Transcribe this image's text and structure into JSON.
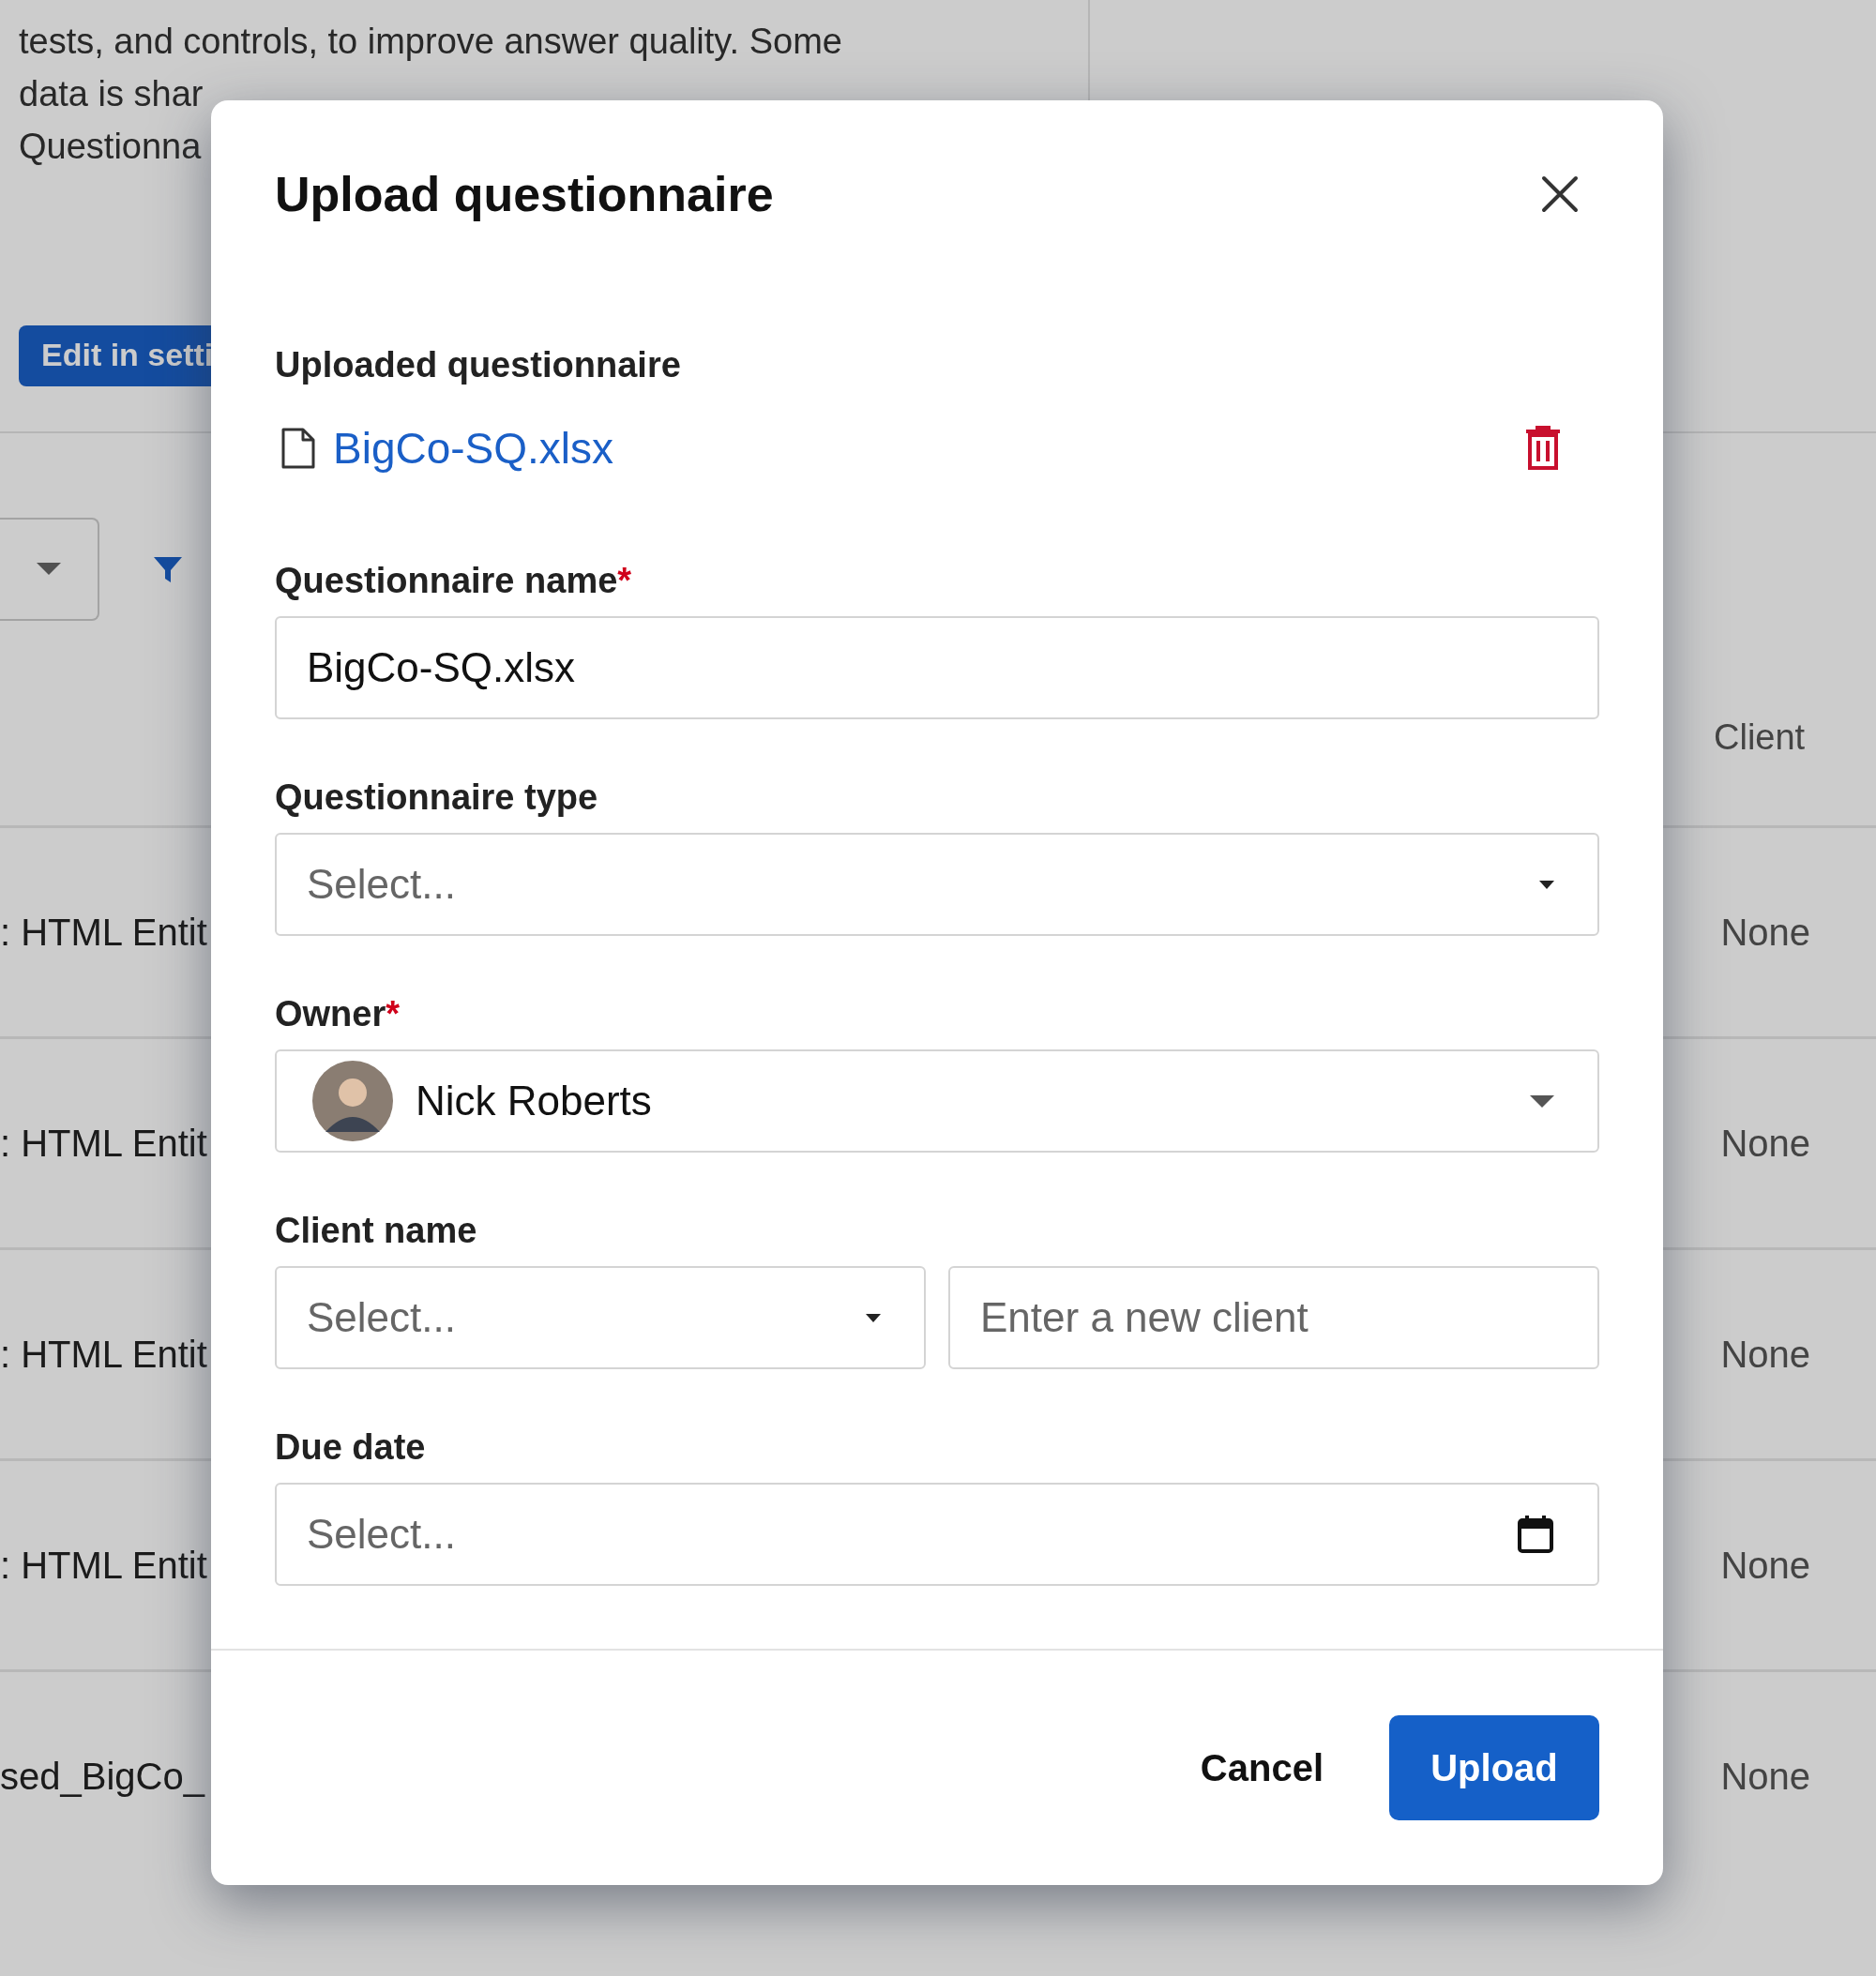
{
  "background": {
    "notice_lines": [
      "tests, and controls, to improve answer quality. Some",
      "data is shar",
      "Questionna"
    ],
    "edit_button": "Edit in setti",
    "table": {
      "column_header": "Client",
      "rows": [
        {
          "name": ": HTML Entit",
          "client": "None"
        },
        {
          "name": ": HTML Entit",
          "client": "None"
        },
        {
          "name": ": HTML Entit",
          "client": "None"
        },
        {
          "name": ": HTML Entit",
          "client": "None"
        },
        {
          "name": "sed_BigCo_",
          "client": "None"
        }
      ]
    }
  },
  "dialog": {
    "title": "Upload questionnaire",
    "uploaded": {
      "label": "Uploaded questionnaire",
      "file": "BigCo-SQ.xlsx"
    },
    "fields": [
      {
        "kind": "text",
        "label": "Questionnaire name",
        "required_mark": "*",
        "value": "BigCo-SQ.xlsx"
      },
      {
        "kind": "select",
        "label": "Questionnaire type",
        "placeholder": "Select..."
      },
      {
        "kind": "owner",
        "label": "Owner",
        "required_mark": "*",
        "value": "Nick Roberts"
      },
      {
        "kind": "client",
        "label": "Client name",
        "placeholder": "Select...",
        "new_placeholder": "Enter a new client"
      },
      {
        "kind": "date",
        "label": "Due date",
        "placeholder": "Select..."
      }
    ],
    "buttons": {
      "cancel": "Cancel",
      "upload": "Upload"
    }
  }
}
